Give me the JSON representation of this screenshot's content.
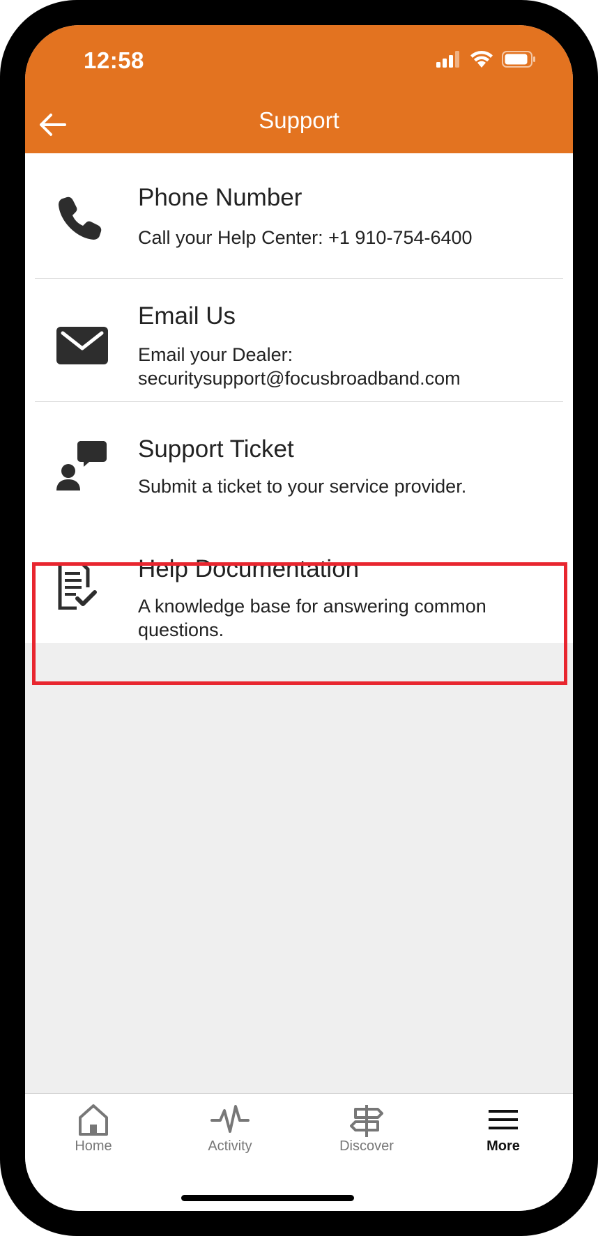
{
  "status_bar": {
    "time": "12:58"
  },
  "header": {
    "title": "Support",
    "background": "#e37320"
  },
  "items": [
    {
      "icon": "phone-icon",
      "title": "Phone Number",
      "description": "Call your Help Center: +1 910-754-6400"
    },
    {
      "icon": "envelope-icon",
      "title": "Email Us",
      "description_line1": "Email your Dealer:",
      "description_line2": "securitysupport@focusbroadband.com"
    },
    {
      "icon": "support-ticket-icon",
      "title": "Support Ticket",
      "description": "Submit a ticket to your service provider."
    },
    {
      "icon": "document-check-icon",
      "title": "Help Documentation",
      "description_line1": "A knowledge base for answering common",
      "description_line2": "questions."
    }
  ],
  "highlight_color": "#e8262f",
  "tabbar": {
    "tabs": [
      {
        "icon": "home-icon",
        "label": "Home",
        "active": false
      },
      {
        "icon": "activity-icon",
        "label": "Activity",
        "active": false
      },
      {
        "icon": "signpost-icon",
        "label": "Discover",
        "active": false
      },
      {
        "icon": "menu-icon",
        "label": "More",
        "active": true
      }
    ]
  }
}
